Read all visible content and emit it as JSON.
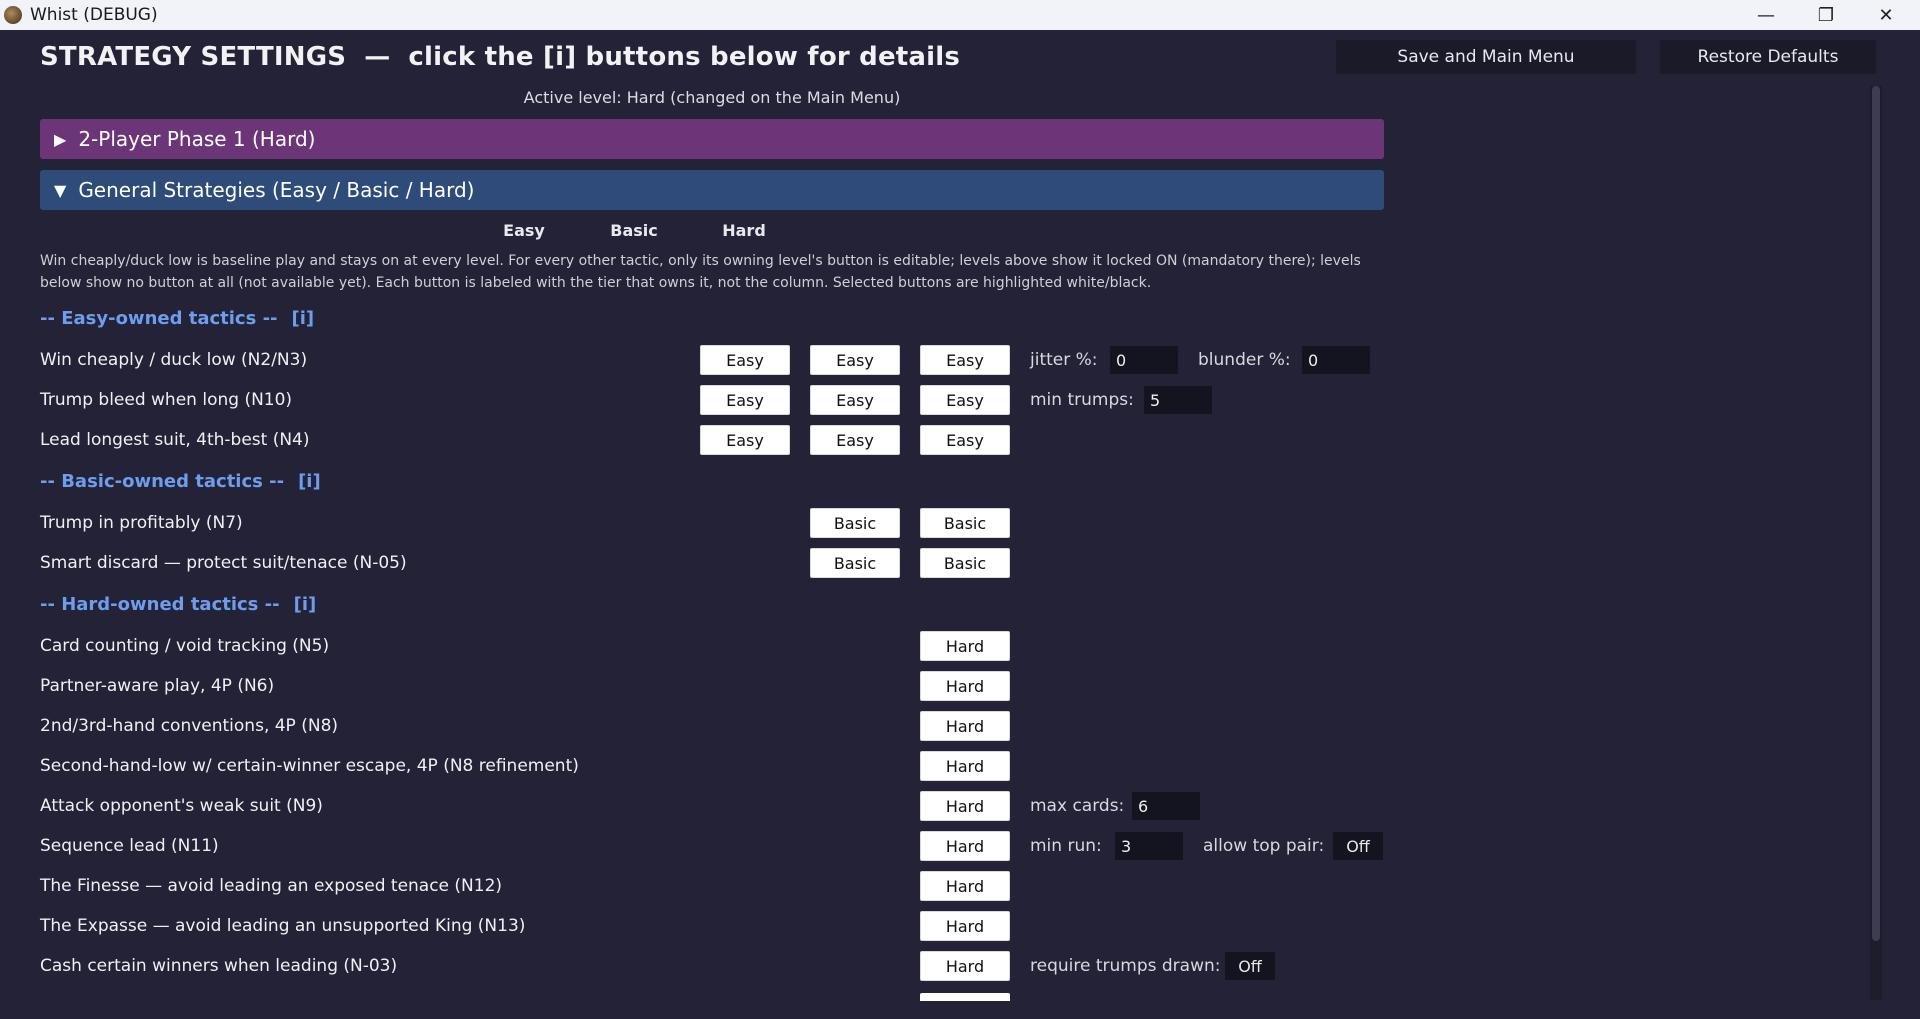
{
  "window": {
    "title": "Whist (DEBUG)",
    "controls": {
      "minimize": "—",
      "maximize": "❐",
      "close": "✕"
    }
  },
  "header": {
    "title": "STRATEGY SETTINGS",
    "separator": "—",
    "subtitle": "click the [i] buttons below for details",
    "save_label": "Save and Main Menu",
    "restore_label": "Restore Defaults",
    "active_level": "Active level: Hard  (changed on the Main Menu)"
  },
  "sections": {
    "two_player": {
      "arrow": "▶",
      "label": "2-Player Phase 1 (Hard)"
    },
    "general": {
      "arrow": "▼",
      "label": "General Strategies (Easy / Basic / Hard)"
    }
  },
  "columns": {
    "easy": "Easy",
    "basic": "Basic",
    "hard": "Hard"
  },
  "description": "Win cheaply/duck low is baseline play and stays on at every level. For every other tactic, only its owning level's button is editable; levels above show it locked ON (mandatory there); levels below show no button at all (not available yet). Each button is labeled with the tier that owns it, not the column. Selected buttons are highlighted white/black.",
  "groups": {
    "easy": {
      "title": "-- Easy-owned tactics --",
      "info": "[i]"
    },
    "basic": {
      "title": "-- Basic-owned tactics --",
      "info": "[i]"
    },
    "hard": {
      "title": "-- Hard-owned tactics --",
      "info": "[i]"
    }
  },
  "tactics": {
    "n2": {
      "label": "Win cheaply / duck low (N2/N3)",
      "btn": "Easy",
      "p1_label": "jitter %:",
      "p1_value": "0",
      "p2_label": "blunder %:",
      "p2_value": "0"
    },
    "n10": {
      "label": "Trump bleed when long (N10)",
      "btn": "Easy",
      "p1_label": "min trumps:",
      "p1_value": "5"
    },
    "n4": {
      "label": "Lead longest suit, 4th-best (N4)",
      "btn": "Easy"
    },
    "n7": {
      "label": "Trump in profitably (N7)",
      "btn": "Basic"
    },
    "n05": {
      "label": "Smart discard — protect suit/tenace (N-05)",
      "btn": "Basic"
    },
    "n5": {
      "label": "Card counting / void tracking (N5)",
      "btn": "Hard"
    },
    "n6": {
      "label": "Partner-aware play, 4P (N6)",
      "btn": "Hard"
    },
    "n8": {
      "label": "2nd/3rd-hand conventions, 4P (N8)",
      "btn": "Hard"
    },
    "n8r": {
      "label": "Second-hand-low w/ certain-winner escape, 4P (N8 refinement)",
      "btn": "Hard"
    },
    "n9": {
      "label": "Attack opponent's weak suit (N9)",
      "btn": "Hard",
      "p1_label": "max cards:",
      "p1_value": "6"
    },
    "n11": {
      "label": "Sequence lead (N11)",
      "btn": "Hard",
      "p1_label": "min run:",
      "p1_value": "3",
      "p2_label": "allow top pair:",
      "p2_value": "Off"
    },
    "n12": {
      "label": "The Finesse — avoid leading an exposed tenace (N12)",
      "btn": "Hard"
    },
    "n13": {
      "label": "The Expasse — avoid leading an unsupported King (N13)",
      "btn": "Hard"
    },
    "n03": {
      "label": "Cash certain winners when leading (N-03)",
      "btn": "Hard",
      "p1_label": "require trumps drawn:",
      "p1_value": "Off"
    }
  }
}
